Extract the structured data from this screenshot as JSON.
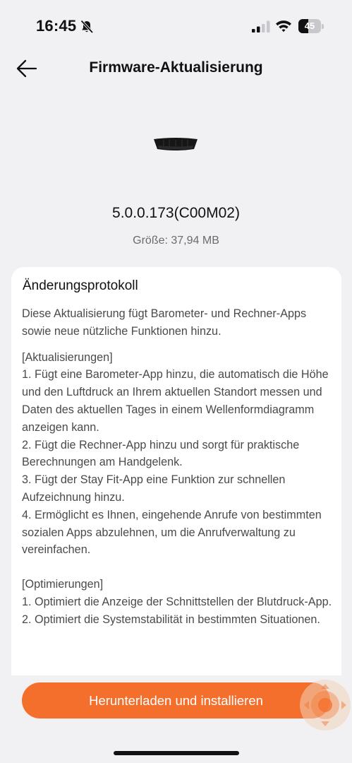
{
  "status_bar": {
    "time": "16:45",
    "battery_level": "45",
    "battery_fraction": 0.45
  },
  "header": {
    "title": "Firmware-Aktualisierung",
    "back_icon": "arrow-left-icon"
  },
  "firmware": {
    "version": "5.0.0.173(C00M02)",
    "size": "Größe: 37,94 MB"
  },
  "changelog": {
    "title": "Änderungsprotokoll",
    "intro": "Diese Aktualisierung fügt Barometer- und Rechner-Apps sowie neue nützliche Funktionen hinzu.",
    "updates_heading": "[Aktualisierungen]",
    "updates": [
      "1. Fügt eine Barometer-App hinzu, die automatisch die Höhe und den Luftdruck an Ihrem aktuellen Standort messen und Daten des aktuellen Tages in einem Wellenformdiagramm anzeigen kann.",
      "2. Fügt die Rechner-App hinzu und sorgt für praktische Berechnungen am Handgelenk.",
      "3. Fügt der Stay Fit-App eine Funktion zur schnellen Aufzeichnung hinzu.",
      "4. Ermöglicht es Ihnen, eingehende Anrufe von bestimmten sozialen Apps abzulehnen, um die Anrufverwaltung zu vereinfachen."
    ],
    "optimizations_heading": "[Optimierungen]",
    "optimizations": [
      "1. Optimiert die Anzeige der Schnittstellen der Blutdruck-App.",
      "2. Optimiert die Systemstabilität in bestimmten Situationen."
    ]
  },
  "actions": {
    "install_label": "Herunterladen und installieren"
  },
  "colors": {
    "accent": "#f46f2c",
    "background": "#f1f1f3",
    "card": "#ffffff"
  }
}
